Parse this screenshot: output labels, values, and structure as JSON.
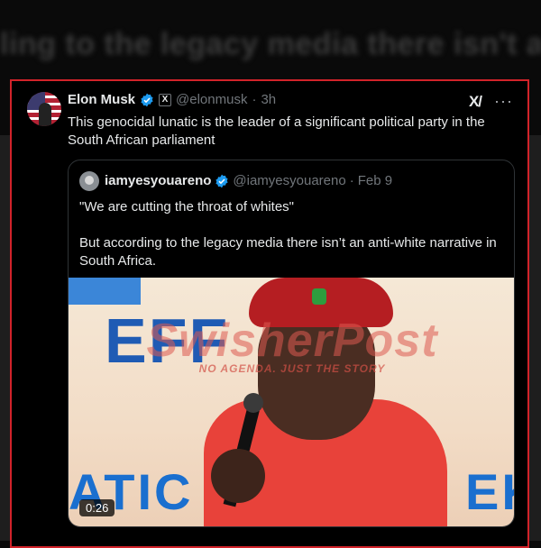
{
  "background": {
    "headline": "ling to the legacy media there isn't an anti-w"
  },
  "post": {
    "author_name": "Elon Musk",
    "affiliate_badge": "X",
    "handle": "@elonmusk",
    "separator": "·",
    "time": "3h",
    "text": "This genocidal lunatic is the leader of a significant political party in the South African parliament",
    "grok_label": "X/",
    "more_label": "···"
  },
  "quote": {
    "author_name": "iamyesyouareno",
    "handle": "@iamyesyouareno",
    "separator": "·",
    "date": "Feb 9",
    "line1": "\"We are cutting the throat of whites\"",
    "line2": "But according to the legacy media there isn’t an anti-white narrative in South Africa.",
    "video": {
      "duration": "0:26",
      "banner_top": "EFF",
      "banner_left": "ATIC",
      "banner_right": "EK"
    }
  },
  "watermark": {
    "brand": "SwisherPost",
    "tagline": "NO AGENDA. JUST THE STORY"
  },
  "colors": {
    "frame_border": "#d2232a",
    "verified": "#1d9bf0",
    "muted": "#71767b"
  }
}
